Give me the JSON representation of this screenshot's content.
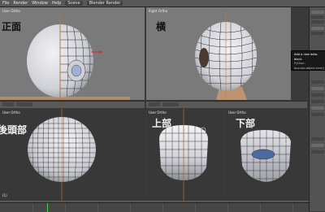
{
  "topbar": {
    "menu_items": [
      "File",
      "Render",
      "Window",
      "Help"
    ],
    "scene_field": "Scene",
    "render_field": "Blender Render"
  },
  "viewports": {
    "front": {
      "label": "正面",
      "info": "User Ortho"
    },
    "side": {
      "label": "横",
      "info": "Right Ortho"
    },
    "back": {
      "label": "後頭部",
      "info": "User Ortho"
    },
    "top": {
      "label": "上部",
      "info": "User Ortho"
    },
    "bottom": {
      "label": "下部",
      "info": "User Ortho"
    }
  },
  "tooltip": {
    "title": "Add a new data-block",
    "detail": "Python: bpy.ops.object.new()"
  },
  "colors": {
    "accent_orange": "#d37a2a",
    "mesh_face": "#d8d8de",
    "wire": "#2b2b2b",
    "axis_red": "#d23030",
    "axis_green": "#4fcf4f",
    "axis_blue": "#3a5fd8"
  }
}
